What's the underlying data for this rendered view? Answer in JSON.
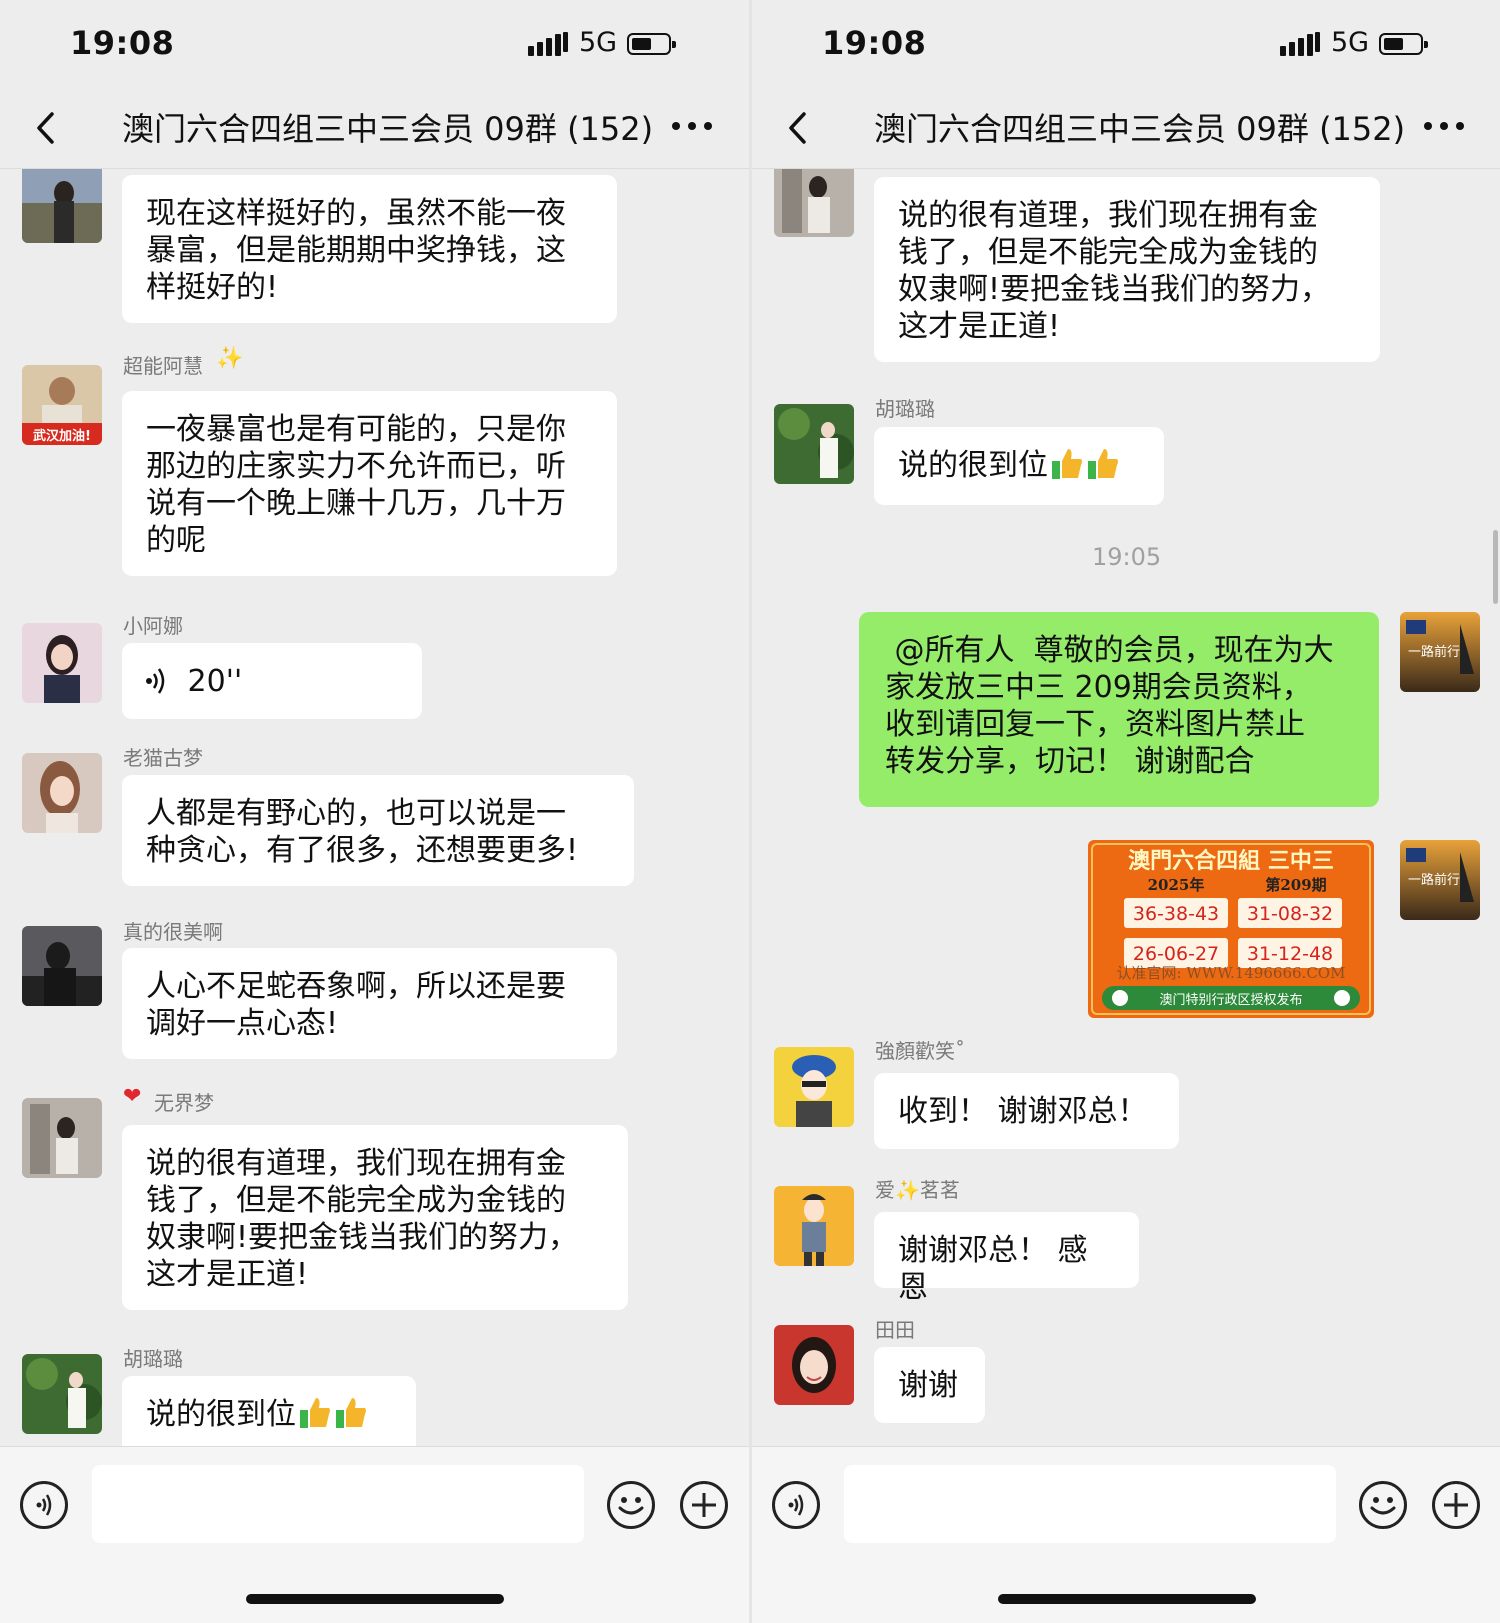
{
  "status": {
    "time": "19:08",
    "network": "5G"
  },
  "header": {
    "title": "澳门六合四组三中三会员 09群 (152)"
  },
  "left": {
    "messages": [
      {
        "text": [
          "现在这样挺好的，虽然不能一夜",
          "暴富，但是能期期中奖挣钱，这",
          "样挺好的!"
        ]
      },
      {
        "sender": "超能阿慧",
        "avatar_caption": "武汉加油!",
        "text": [
          "一夜暴富也是有可能的，只是你",
          "那边的庄家实力不允许而已，听",
          "说有一个晚上赚十几万，几十万",
          "的呢"
        ]
      },
      {
        "sender": "小阿娜",
        "voice": "20''"
      },
      {
        "sender": "老猫古梦",
        "text": [
          "人都是有野心的，也可以说是一",
          "种贪心，有了很多，还想要更多!"
        ]
      },
      {
        "sender": "真的很美啊",
        "text": [
          "人心不足蛇吞象啊，所以还是要",
          "调好一点心态!"
        ]
      },
      {
        "sender": "无界梦",
        "text": [
          "说的很有道理，我们现在拥有金",
          "钱了，但是不能完全成为金钱的",
          "奴隶啊!要把金钱当我们的努力，",
          "这才是正道!"
        ]
      },
      {
        "sender": "胡璐璐",
        "text": [
          "说的很到位"
        ]
      }
    ]
  },
  "right": {
    "messages": [
      {
        "text": [
          "说的很有道理，我们现在拥有金",
          "钱了，但是不能完全成为金钱的",
          "奴隶啊!要把金钱当我们的努力，",
          "这才是正道!"
        ]
      },
      {
        "sender": "胡璐璐",
        "text": [
          "说的很到位"
        ]
      },
      {
        "timestamp": "19:05"
      },
      {
        "self": true,
        "avatar_caption": "一路前行",
        "text": [
          " @所有人  尊敬的会员，现在为大",
          "家发放三中三 209期会员资料，",
          "收到请回复一下，资料图片禁止",
          "转发分享，切记！ 谢谢配合"
        ]
      },
      {
        "self": true,
        "avatar_caption": "一路前行",
        "image": {
          "title": "澳門六合四組 三中三",
          "year": "2025年",
          "issue": "第209期",
          "numbers": [
            "36-38-43",
            "31-08-32",
            "26-06-27",
            "31-12-48"
          ],
          "watermark": "认准官网: WWW.1496666.COM",
          "footer": "澳门特别行政区授权发布"
        }
      },
      {
        "sender": "強顏歡笑˚",
        "text": [
          "收到！ 谢谢邓总！"
        ]
      },
      {
        "sender": "爱✨茗茗",
        "text": [
          "谢谢邓总！ 感恩"
        ]
      },
      {
        "sender": "田田",
        "text": [
          "谢谢"
        ]
      }
    ]
  },
  "colors": {
    "background": "#ededed",
    "bubble": "#ffffff",
    "self_bubble": "#95ec69",
    "sender": "#7a7a7a"
  }
}
